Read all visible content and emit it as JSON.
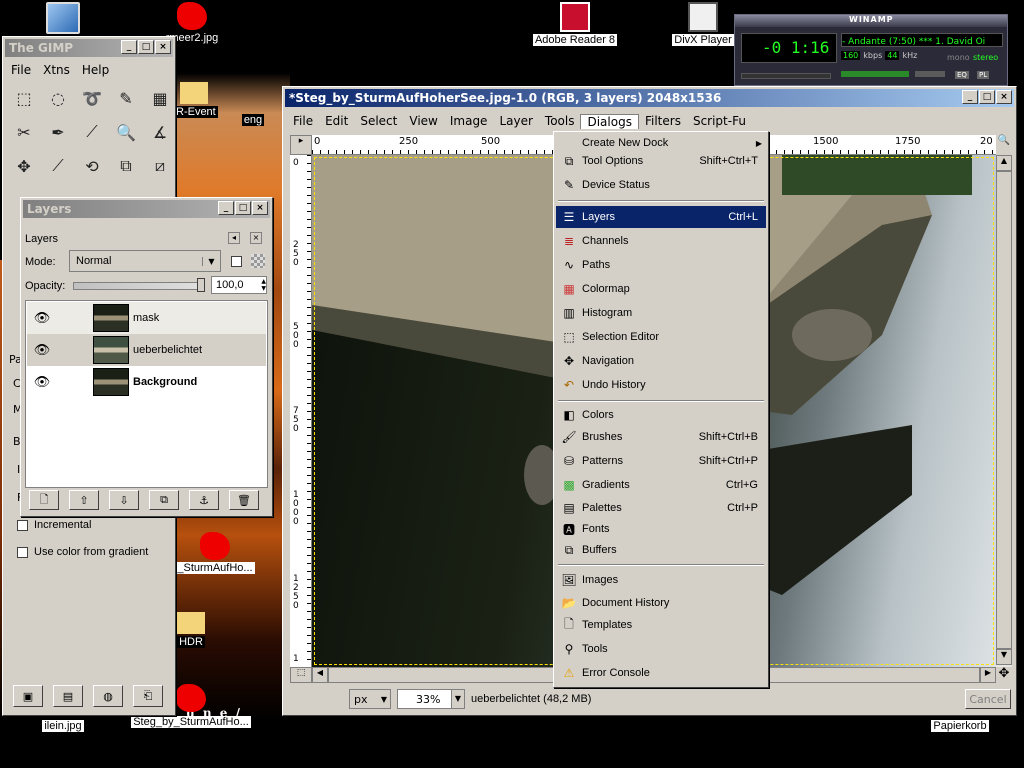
{
  "desktop": {
    "icons": [
      {
        "label": "",
        "name": "my-computer-icon"
      },
      {
        "label": "rmeer2.jpg",
        "name": "image-file-icon"
      },
      {
        "label": "Adobe Reader 8",
        "name": "adobe-reader-icon"
      },
      {
        "label": "DivX Player",
        "name": "divx-player-icon"
      },
      {
        "label": "R-Event",
        "name": "folder-icon"
      },
      {
        "label": "eng",
        "name": "file-icon"
      },
      {
        "label": "_SturmAufHo...",
        "name": "image-file-icon"
      },
      {
        "label": "HDR",
        "name": "folder-icon"
      },
      {
        "label": "ilein.jpg",
        "name": "image-file-icon"
      },
      {
        "label": "Steg_by_SturmAufHo...",
        "name": "image-file-icon"
      },
      {
        "label": "Papierkorb",
        "name": "recycle-bin-icon"
      }
    ],
    "wallpaper_text": "u n e /"
  },
  "winamp": {
    "title": "WINAMP",
    "time": "-0 1:16",
    "track": "- Andante (7:50) *** 1. David Oi",
    "kbps": "160",
    "kbps_unit": "kbps",
    "khz": "44",
    "khz_unit": "kHz",
    "mono": "mono",
    "stereo": "stereo",
    "eq": "EQ",
    "pl": "PL"
  },
  "gimp_toolbox": {
    "title": "The GIMP",
    "menu": [
      "File",
      "Xtns",
      "Help"
    ],
    "options": {
      "incremental": "Incremental",
      "use_color_gradient": "Use color from gradient"
    },
    "partial_labels": [
      "Pa",
      "C",
      "M",
      "B",
      "I",
      "F"
    ]
  },
  "layers_dialog": {
    "title": "Layers",
    "tab_label": "Layers",
    "mode_label": "Mode:",
    "mode_value": "Normal",
    "opacity_label": "Opacity:",
    "opacity_value": "100,0",
    "layers": [
      {
        "name": "mask",
        "bold": false
      },
      {
        "name": "ueberbelichtet",
        "bold": false
      },
      {
        "name": "Background",
        "bold": true
      }
    ]
  },
  "image_window": {
    "title": "*Steg_by_SturmAufHoherSee.jpg-1.0 (RGB, 3 layers) 2048x1536",
    "menu": [
      "File",
      "Edit",
      "Select",
      "View",
      "Image",
      "Layer",
      "Tools",
      "Dialogs",
      "Filters",
      "Script-Fu"
    ],
    "open_menu": "Dialogs",
    "ruler_h": [
      "0",
      "250",
      "500",
      "1500",
      "1750",
      "20"
    ],
    "ruler_v": [
      "0",
      "250",
      "500",
      "750",
      "1000",
      "1250",
      "1"
    ],
    "unit": "px",
    "zoom": "33%",
    "status": "ueberbelichtet (48,2 MB)",
    "cancel": "Cancel"
  },
  "dialogs_menu": [
    {
      "label": "Create New Dock",
      "shortcut": "",
      "icon": "",
      "submenu": true
    },
    {
      "label": "Tool Options",
      "shortcut": "Shift+Ctrl+T",
      "icon": "tool-options-icon"
    },
    {
      "label": "Device Status",
      "shortcut": "",
      "icon": "device-status-icon"
    },
    {
      "sep": true
    },
    {
      "label": "Layers",
      "shortcut": "Ctrl+L",
      "icon": "layers-icon",
      "highlighted": true
    },
    {
      "label": "Channels",
      "shortcut": "",
      "icon": "channels-icon"
    },
    {
      "label": "Paths",
      "shortcut": "",
      "icon": "paths-icon"
    },
    {
      "label": "Colormap",
      "shortcut": "",
      "icon": "colormap-icon"
    },
    {
      "label": "Histogram",
      "shortcut": "",
      "icon": "histogram-icon"
    },
    {
      "label": "Selection Editor",
      "shortcut": "",
      "icon": "selection-editor-icon"
    },
    {
      "label": "Navigation",
      "shortcut": "",
      "icon": "navigation-icon"
    },
    {
      "label": "Undo History",
      "shortcut": "",
      "icon": "undo-history-icon"
    },
    {
      "sep": true
    },
    {
      "label": "Colors",
      "shortcut": "",
      "icon": "colors-icon"
    },
    {
      "label": "Brushes",
      "shortcut": "Shift+Ctrl+B",
      "icon": "brushes-icon"
    },
    {
      "label": "Patterns",
      "shortcut": "Shift+Ctrl+P",
      "icon": "patterns-icon"
    },
    {
      "label": "Gradients",
      "shortcut": "Ctrl+G",
      "icon": "gradients-icon"
    },
    {
      "label": "Palettes",
      "shortcut": "Ctrl+P",
      "icon": "palettes-icon"
    },
    {
      "label": "Fonts",
      "shortcut": "",
      "icon": "fonts-icon"
    },
    {
      "label": "Buffers",
      "shortcut": "",
      "icon": "buffers-icon"
    },
    {
      "sep": true
    },
    {
      "label": "Images",
      "shortcut": "",
      "icon": "images-icon"
    },
    {
      "label": "Document History",
      "shortcut": "",
      "icon": "document-history-icon"
    },
    {
      "label": "Templates",
      "shortcut": "",
      "icon": "templates-icon"
    },
    {
      "label": "Tools",
      "shortcut": "",
      "icon": "tools-icon"
    },
    {
      "label": "Error Console",
      "shortcut": "",
      "icon": "error-console-icon"
    }
  ],
  "colors": {
    "highlight": "#0a246a",
    "title_active": "#0a246a",
    "window_face": "#d4d0c8",
    "wallpaper": "#c8641e"
  }
}
